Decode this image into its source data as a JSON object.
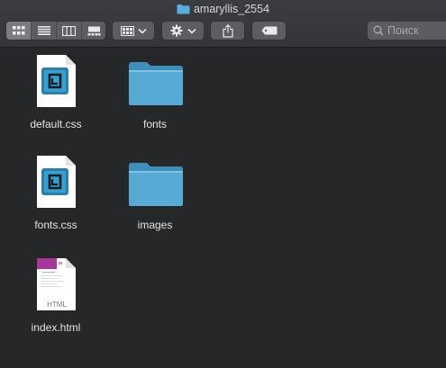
{
  "window": {
    "title": "amaryllis_2554"
  },
  "toolbar": {
    "view_modes": [
      "icon-view",
      "list-view",
      "column-view",
      "gallery-view"
    ],
    "active_view": "icon-view",
    "arrange_label": "arrange-menu",
    "action_label": "action-menu",
    "share_label": "share",
    "tag_label": "tags",
    "search_placeholder": "Поиск"
  },
  "files": [
    {
      "name": "default.css",
      "kind": "css-document"
    },
    {
      "name": "fonts",
      "kind": "folder"
    },
    {
      "name": "fonts.css",
      "kind": "css-document"
    },
    {
      "name": "images",
      "kind": "folder"
    },
    {
      "name": "index.html",
      "kind": "html-document",
      "badge": "HTML"
    }
  ],
  "colors": {
    "background": "#252729",
    "folder": "#57a9d6",
    "css_icon_accent": "#2c7fa8",
    "html_icon_accent": "#a6369a"
  }
}
